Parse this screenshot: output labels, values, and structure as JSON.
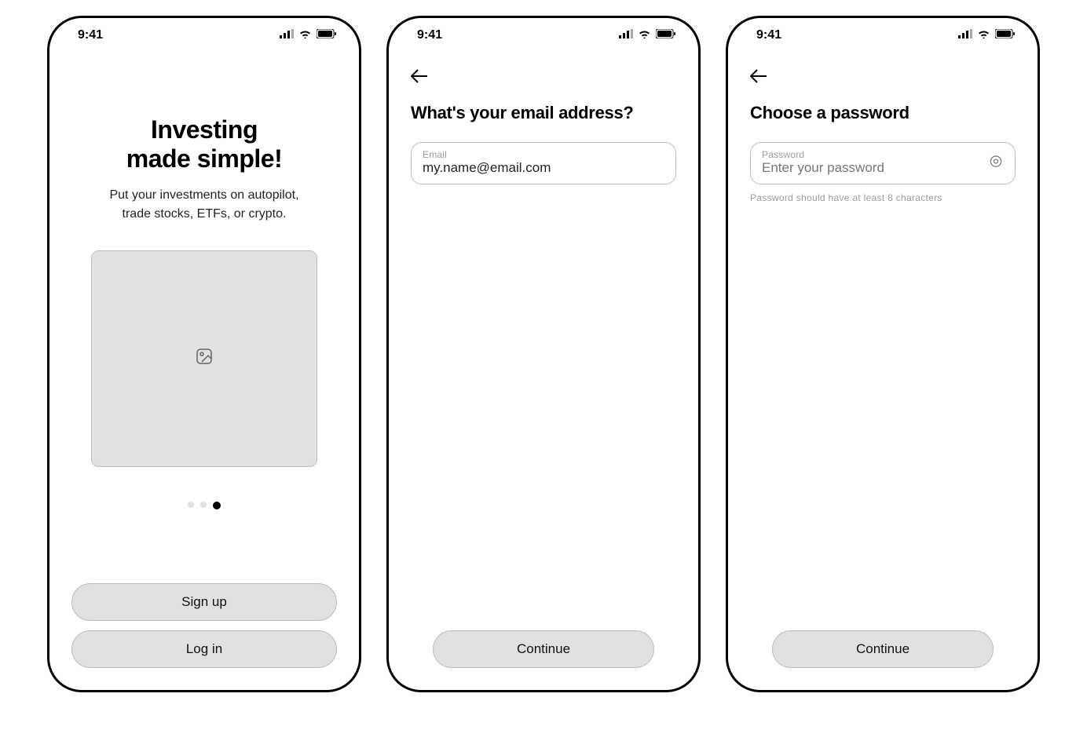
{
  "statusbar": {
    "time": "9:41"
  },
  "screen1": {
    "title_line1": "Investing",
    "title_line2": "made simple!",
    "subtitle_line1": "Put your investments on autopilot,",
    "subtitle_line2": "trade stocks, ETFs, or crypto.",
    "signup_label": "Sign up",
    "login_label": "Log in"
  },
  "screen2": {
    "heading": "What's your email address?",
    "email_label": "Email",
    "email_value": "my.name@email.com",
    "continue_label": "Continue"
  },
  "screen3": {
    "heading": "Choose a password",
    "password_label": "Password",
    "password_placeholder": "Enter your password",
    "hint": "Password should have at least 8 characters",
    "continue_label": "Continue"
  }
}
